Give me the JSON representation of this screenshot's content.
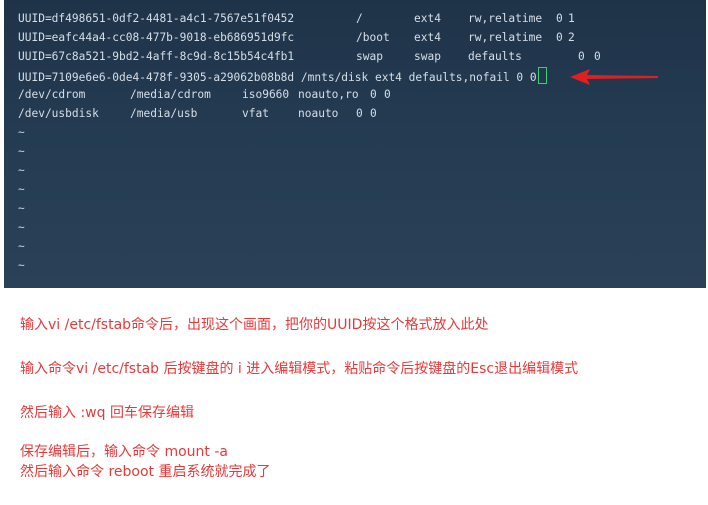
{
  "terminal": {
    "lines": [
      {
        "uuid": "UUID=df498651-0df2-4481-a4c1-7567e51f0452",
        "mount": "/",
        "type": "ext4",
        "options": "rw,relatime",
        "dump": "0",
        "pass": "1"
      },
      {
        "uuid": "UUID=eafc44a4-cc08-477b-9018-eb686951d9fc",
        "mount": "/boot",
        "type": "ext4",
        "options": "rw,relatime",
        "dump": "0",
        "pass": "2"
      },
      {
        "uuid": "UUID=67c8a521-9bd2-4aff-8c9d-8c15b54c4fb1",
        "mount": "swap",
        "type": "swap",
        "options": "defaults",
        "dump": "0",
        "pass": "0"
      },
      {
        "text": "UUID=7109e6e6-0de4-478f-9305-a29062b08b8d /mnts/disk ext4 defaults,nofail 0 0"
      },
      {
        "device": "/dev/cdrom",
        "mount": "/media/cdrom",
        "type": "iso9660",
        "options": "noauto,ro",
        "dump": "0",
        "pass": "0"
      },
      {
        "device": "/dev/usbdisk",
        "mount": "/media/usb",
        "type": "vfat",
        "options": "noauto",
        "dump": "0",
        "pass": "0"
      }
    ],
    "tilde": "~",
    "arrow_color": "#e02020",
    "cursor_color": "#39d16a"
  },
  "instructions": {
    "line1": "输入vi /etc/fstab命令后，出现这个画面，把你的UUID按这个格式放入此处",
    "line2": "输入命令vi /etc/fstab 后按键盘的 i 进入编辑模式，粘贴命令后按键盘的Esc退出编辑模式",
    "line3": "然后输入 :wq  回车保存编辑",
    "line4": "保存编辑后，输入命令 mount -a",
    "line5": "然后输入命令 reboot  重启系统就完成了",
    "color": "#e8393a"
  }
}
